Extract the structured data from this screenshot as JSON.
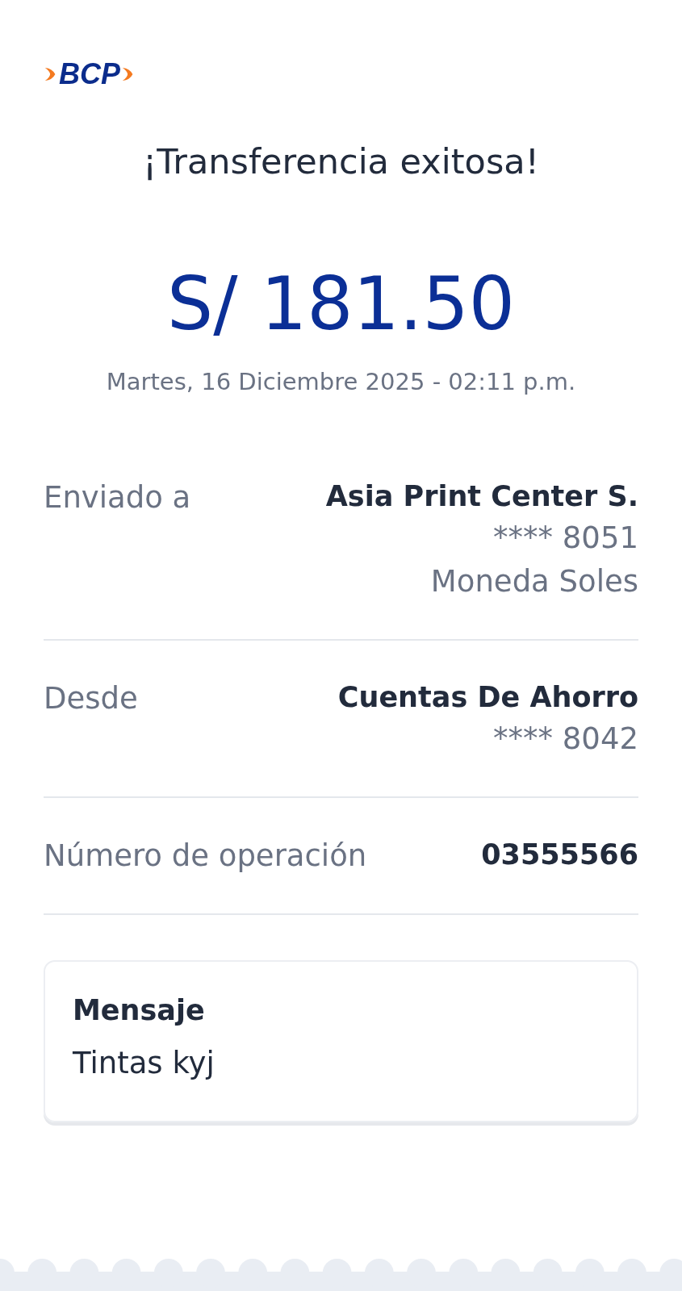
{
  "logo": {
    "text": "BCP"
  },
  "title": "¡Transferencia exitosa!",
  "amount": "S/ 181.50",
  "datetime": "Martes, 16 Diciembre 2025 - 02:11 p.m.",
  "details": [
    {
      "label": "Enviado a",
      "lines": [
        "Asia Print Center S.",
        "**** 8051",
        "Moneda Soles"
      ]
    },
    {
      "label": "Desde",
      "lines": [
        "Cuentas De Ahorro",
        "**** 8042"
      ]
    },
    {
      "label": "Número de operación",
      "lines": [
        "03555566"
      ]
    }
  ],
  "message": {
    "title": "Mensaje",
    "text": "Tintas kyj"
  }
}
